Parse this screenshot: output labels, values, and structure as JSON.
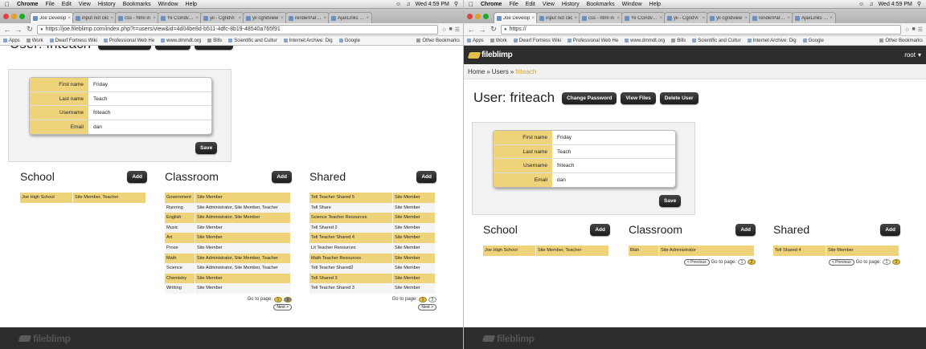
{
  "mac_menu": {
    "apple": "",
    "items": [
      "Chrome",
      "File",
      "Edit",
      "View",
      "History",
      "Bookmarks",
      "Window",
      "Help"
    ],
    "clock": "Wed 4:59 PM"
  },
  "tabs": [
    {
      "label": "Joe Develop"
    },
    {
      "label": "input not clic"
    },
    {
      "label": "css - html in"
    },
    {
      "label": "Yii CGridview"
    },
    {
      "label": "yii - CgridVi"
    },
    {
      "label": "yii cgridview"
    },
    {
      "label": "renderPartial"
    },
    {
      "label": "AjaxLinks wit"
    }
  ],
  "left": {
    "url": "https://joe.fileblimp.com/index.php?r=users/view&id=4d04be8d-b511-4dfc-8b19-48540a765f91",
    "page_title": "User: friteach",
    "sections": {
      "school_rows": [
        [
          "Joe High School",
          "Site Member, Teacher"
        ]
      ],
      "classroom_rows": [
        [
          "Government",
          "Site Member"
        ],
        [
          "Running",
          "Site Administrator, Site Member, Teacher"
        ],
        [
          "English",
          "Site Administrator, Site Member"
        ],
        [
          "Music",
          "Site Member"
        ],
        [
          "Art",
          "Site Member"
        ],
        [
          "Prose",
          "Site Member"
        ],
        [
          "Math",
          "Site Administrator, Site Member, Teacher"
        ],
        [
          "Science",
          "Site Administrator, Site Member, Teacher"
        ],
        [
          "Chemistry",
          "Site Member"
        ],
        [
          "Writting",
          "Site Member"
        ]
      ],
      "shared_rows": [
        [
          "Tell Teacher Shared 5",
          "Site Member"
        ],
        [
          "Tell Share",
          "Site Member"
        ],
        [
          "Science Teacher Resources",
          "Site Member"
        ],
        [
          "Tell Shared 2",
          "Site Member"
        ],
        [
          "Tell Teacher Shared 4",
          "Site Member"
        ],
        [
          "Lit Teacher Resources",
          "Site Member"
        ],
        [
          "Math Teacher Resources",
          "Site Member"
        ],
        [
          "Tell Teacher Shared2",
          "Site Member"
        ],
        [
          "Tell Shared 3",
          "Site Member"
        ],
        [
          "Tell Teacher Shared 3",
          "Site Member"
        ]
      ],
      "classroom_pages": [
        "1",
        "2"
      ],
      "shared_pages": [
        "1",
        "2"
      ]
    }
  },
  "right": {
    "url": "https://",
    "root_label": "root",
    "page_title": "User: friteach",
    "breadcrumb": {
      "home": "Home",
      "users": "Users",
      "current": "friteach",
      "sep": "»"
    },
    "header_buttons": {
      "change_password": "Change Password",
      "view_files": "View Files",
      "delete_user": "Delete User"
    },
    "sections": {
      "school_rows": [
        [
          "Joe High School",
          "Site Member, Teacher"
        ]
      ],
      "classroom_rows": [
        [
          "Blah",
          "Site Administrator"
        ]
      ],
      "shared_rows": [
        [
          "Tell Shared 4",
          "Site Member"
        ]
      ],
      "classroom_pages": [
        "1",
        "2"
      ],
      "shared_pages": [
        "1",
        "2"
      ]
    }
  },
  "bookmarks": {
    "items": [
      {
        "label": "Apps",
        "folder": false
      },
      {
        "label": "Work",
        "folder": true
      },
      {
        "label": "Dwarf Fortress Wiki",
        "folder": false
      },
      {
        "label": "Professional Web He",
        "folder": false
      },
      {
        "label": "www.dmmdt.org",
        "folder": false
      },
      {
        "label": "Bills",
        "folder": true
      },
      {
        "label": "Scientific and Cultur",
        "folder": false
      },
      {
        "label": "Internet Archive: Dig",
        "folder": false
      },
      {
        "label": "Google",
        "folder": false
      }
    ],
    "other": "Other Bookmarks"
  },
  "user_info": {
    "first_name_label": "First name",
    "first_name": "Friday",
    "last_name_label": "Last name",
    "last_name": "Teach",
    "username_label": "Username",
    "username": "friteach",
    "email_label": "Email",
    "email": "dan"
  },
  "labels": {
    "save": "Save",
    "add": "Add",
    "school": "School",
    "classroom": "Classroom",
    "shared": "Shared",
    "go_to_page": "Go to page:",
    "previous": "< Previous",
    "next": "Next >",
    "logo": "fileblimp"
  },
  "colors": {
    "accent_yellow": "#efd37a",
    "page_selected": "#e2c04a",
    "dark_bar": "#2d2d2d"
  }
}
